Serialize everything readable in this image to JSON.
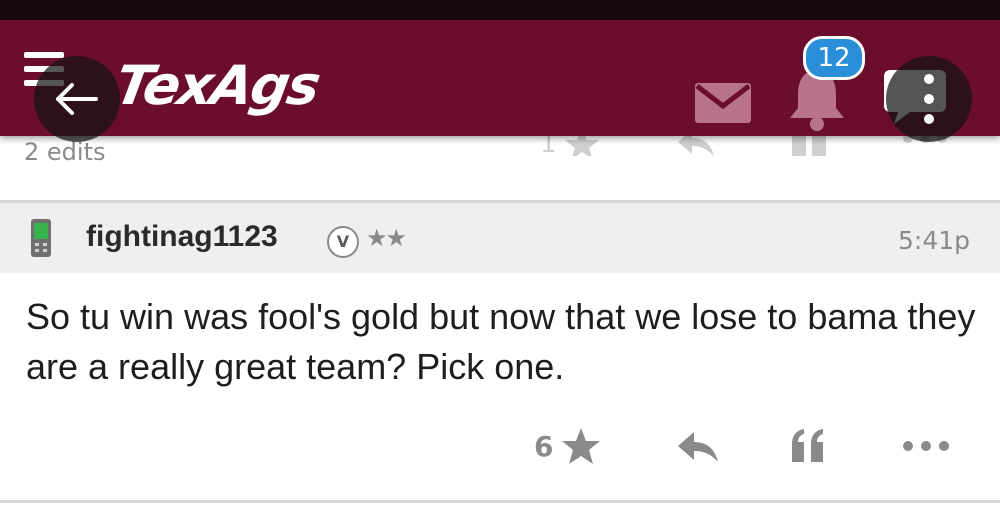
{
  "header": {
    "logo": "TexAgs",
    "notification_count": "12"
  },
  "previous_post": {
    "edits": "2 edits"
  },
  "post": {
    "username": "fightinag1123",
    "badge": "V",
    "rank_stars": "★★",
    "time": "5:41p",
    "text": "So tu win was fool's gold but now that we lose to bama they are a really great team? Pick one.",
    "star_count": "6"
  },
  "colors": {
    "header_bg": "#6b0d2c",
    "badge_bg": "#2a8fd8",
    "user_bar_bg": "#efefef",
    "icon_gray": "#8a8a8a"
  }
}
